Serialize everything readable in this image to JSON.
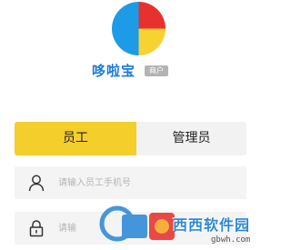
{
  "app": {
    "name": "哆啦宝",
    "tag": "商户"
  },
  "role_tabs": [
    {
      "label": "员工",
      "selected": true
    },
    {
      "label": "管理员",
      "selected": false
    }
  ],
  "phone_field": {
    "placeholder": "请输入员工手机号",
    "value": "",
    "icon": "user-icon"
  },
  "password_field": {
    "placeholder": "请输",
    "value": "",
    "icon": "lock-icon"
  },
  "watermark": {
    "text": "西西软件园",
    "url": "gbwh.com"
  },
  "colors": {
    "brand_blue": "#1a7bd6",
    "active_tab": "#f4ce2a",
    "logo_red": "#e8312f",
    "logo_yellow": "#f6d332",
    "logo_blue": "#1e9be6"
  }
}
